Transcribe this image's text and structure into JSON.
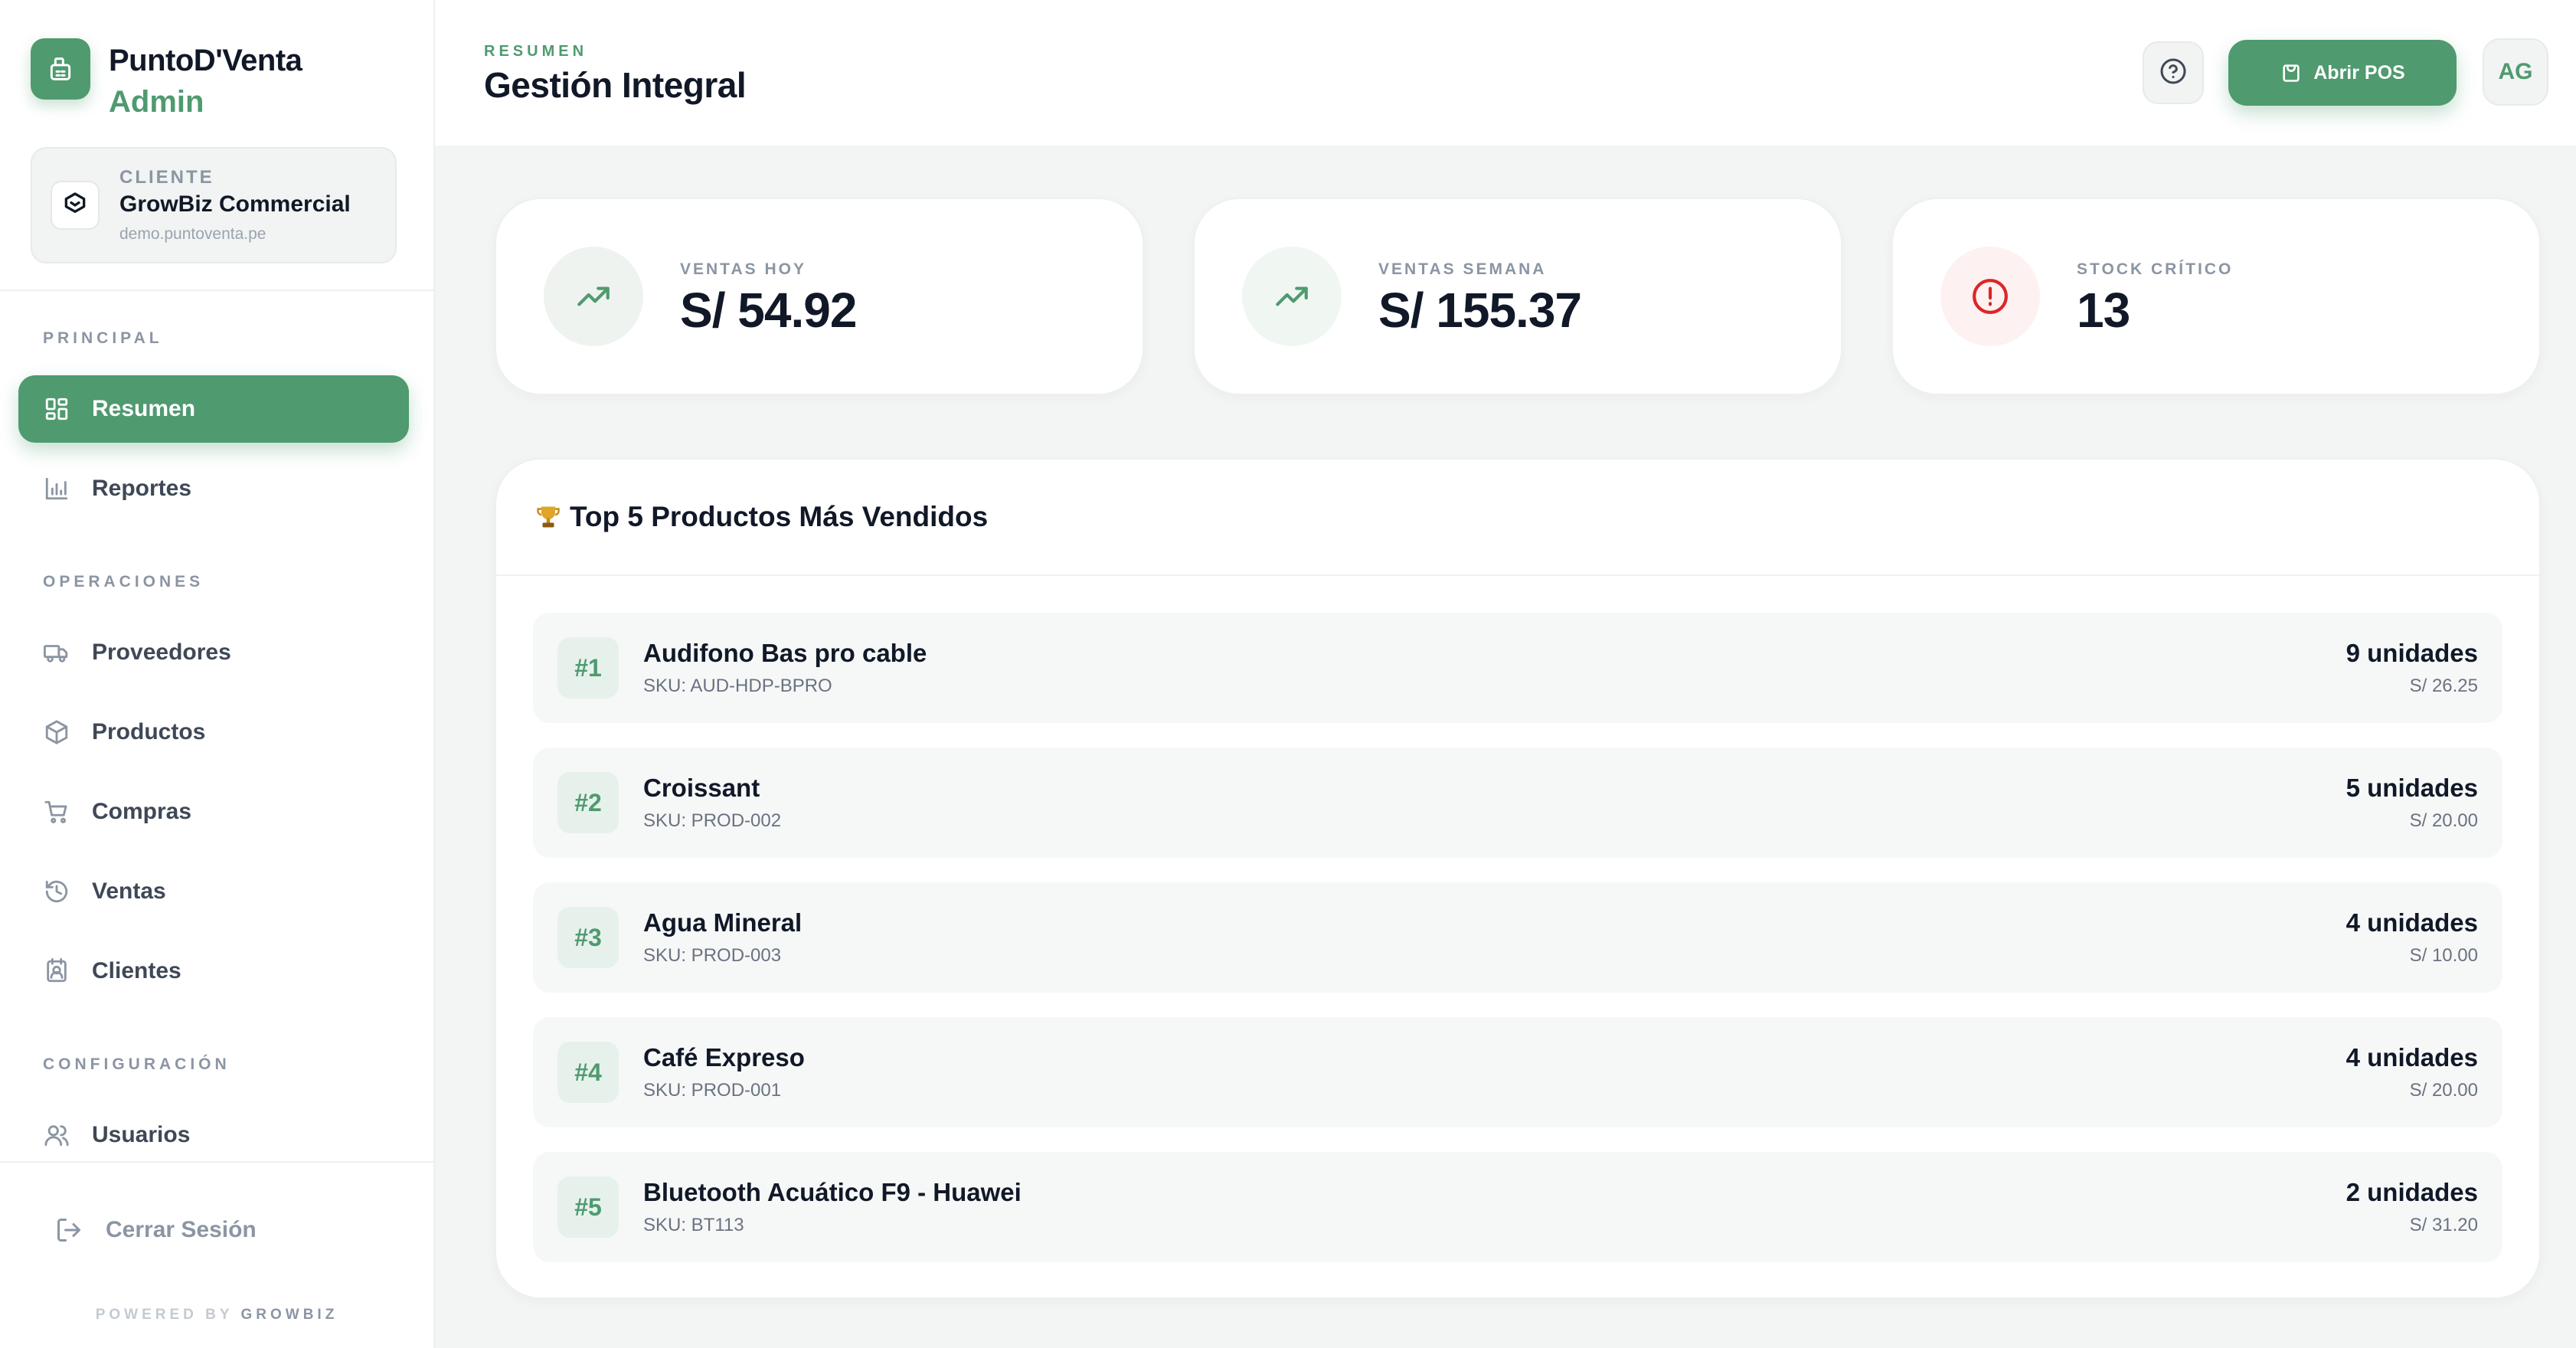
{
  "brand": {
    "name": "PuntoD'Venta",
    "role": "Admin"
  },
  "client": {
    "label": "CLIENTE",
    "name": "GrowBiz Commercial",
    "domain": "demo.puntoventa.pe"
  },
  "sidebar": {
    "sections": [
      {
        "label": "PRINCIPAL"
      },
      {
        "label": "OPERACIONES"
      },
      {
        "label": "CONFIGURACIÓN"
      }
    ],
    "items": [
      {
        "label": "Resumen",
        "icon": "grid-icon",
        "active": true
      },
      {
        "label": "Reportes",
        "icon": "bar-chart-icon"
      },
      {
        "label": "Proveedores",
        "icon": "truck-icon"
      },
      {
        "label": "Productos",
        "icon": "box-icon"
      },
      {
        "label": "Compras",
        "icon": "cart-icon"
      },
      {
        "label": "Ventas",
        "icon": "history-icon"
      },
      {
        "label": "Clientes",
        "icon": "contact-icon"
      },
      {
        "label": "Usuarios",
        "icon": "users-icon"
      }
    ],
    "logout_label": "Cerrar Sesión",
    "powered_prefix": "POWERED BY",
    "powered_brand": "GROWBIZ"
  },
  "header": {
    "eyebrow": "RESUMEN",
    "title": "Gestión Integral",
    "pos_label": "Abrir POS",
    "avatar_initials": "AG"
  },
  "stats": [
    {
      "label": "VENTAS HOY",
      "value": "S/ 54.92",
      "icon": "trending-up-icon"
    },
    {
      "label": "VENTAS SEMANA",
      "value": "S/ 155.37",
      "icon": "trending-up-icon"
    },
    {
      "label": "STOCK CRÍTICO",
      "value": "13",
      "icon": "alert-circle-icon"
    }
  ],
  "top_products": {
    "title": "Top 5 Productos Más Vendidos",
    "items": [
      {
        "rank": "#1",
        "name": "Audifono Bas pro cable",
        "sku": "SKU: AUD-HDP-BPRO",
        "units": "9 unidades",
        "amount": "S/ 26.25"
      },
      {
        "rank": "#2",
        "name": "Croissant",
        "sku": "SKU: PROD-002",
        "units": "5 unidades",
        "amount": "S/ 20.00"
      },
      {
        "rank": "#3",
        "name": "Agua Mineral",
        "sku": "SKU: PROD-003",
        "units": "4 unidades",
        "amount": "S/ 10.00"
      },
      {
        "rank": "#4",
        "name": "Café Expreso",
        "sku": "SKU: PROD-001",
        "units": "4 unidades",
        "amount": "S/ 20.00"
      },
      {
        "rank": "#5",
        "name": "Bluetooth Acuático F9 - Huawei",
        "sku": "SKU: BT113",
        "units": "2 unidades",
        "amount": "S/ 31.20"
      }
    ]
  },
  "colors": {
    "accent": "#4f9a6f",
    "danger": "#dc2626",
    "text": "#111827",
    "muted": "#8b95a3"
  }
}
